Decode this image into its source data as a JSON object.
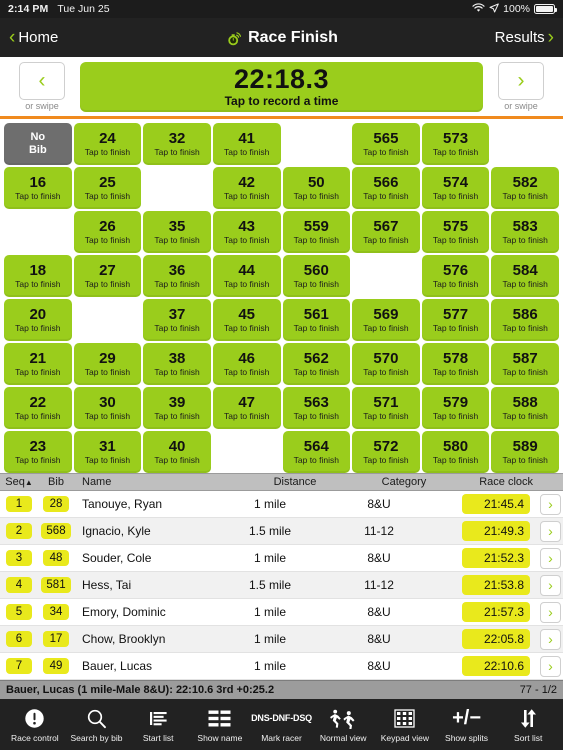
{
  "status_bar": {
    "time": "2:14 PM",
    "date": "Tue Jun 25",
    "wifi_icon": "wifi-icon",
    "location_icon": "location-arrow-icon",
    "battery_pct": "100%",
    "battery_icon": "battery-full-icon"
  },
  "nav": {
    "back_label": "Home",
    "back_icon": "chevron-left-icon",
    "title": "Race Finish",
    "logo_icon": "stopwatch-signal-icon",
    "forward_label": "Results",
    "forward_icon": "chevron-right-icon"
  },
  "timer": {
    "prev_icon": "chevron-left-icon",
    "prev_label": "or swipe",
    "next_icon": "chevron-right-icon",
    "next_label": "or swipe",
    "clock": "22:18.3",
    "hint": "Tap to record a time"
  },
  "colors": {
    "green": "#9ACD1C",
    "yellow": "#E9E91C",
    "orange_rule": "#F08A1E",
    "nobib_gray": "#6E6E6E",
    "dark_chrome": "#222222"
  },
  "grid": {
    "tile_sub": "Tap to finish",
    "no_bib_line1": "No",
    "no_bib_line2": "Bib",
    "columns": 8,
    "rows": [
      [
        "NOBIB",
        "24",
        "32",
        "41",
        "",
        "565",
        "573",
        ""
      ],
      [
        "16",
        "25",
        "",
        "42",
        "50",
        "566",
        "574",
        "582"
      ],
      [
        "",
        "26",
        "35",
        "43",
        "559",
        "567",
        "575",
        "583"
      ],
      [
        "18",
        "27",
        "36",
        "44",
        "560",
        "",
        "576",
        "584"
      ],
      [
        "20",
        "",
        "37",
        "45",
        "561",
        "569",
        "577",
        "586"
      ],
      [
        "21",
        "29",
        "38",
        "46",
        "562",
        "570",
        "578",
        "587"
      ],
      [
        "22",
        "30",
        "39",
        "47",
        "563",
        "571",
        "579",
        "588"
      ],
      [
        "23",
        "31",
        "40",
        "",
        "564",
        "572",
        "580",
        "589"
      ]
    ]
  },
  "results": {
    "headers": {
      "seq": "Seq",
      "seq_sort_icon": "sort-ascending-triangle-icon",
      "bib": "Bib",
      "name": "Name",
      "distance": "Distance",
      "category": "Category",
      "race_clock": "Race clock"
    },
    "row_arrow_icon": "chevron-right-icon",
    "rows": [
      {
        "seq": "1",
        "bib": "28",
        "name": "Tanouye, Ryan",
        "distance": "1 mile",
        "category": "8&U",
        "clock": "21:45.4"
      },
      {
        "seq": "2",
        "bib": "568",
        "name": "Ignacio, Kyle",
        "distance": "1.5 mile",
        "category": "11-12",
        "clock": "21:49.3"
      },
      {
        "seq": "3",
        "bib": "48",
        "name": "Souder, Cole",
        "distance": "1 mile",
        "category": "8&U",
        "clock": "21:52.3"
      },
      {
        "seq": "4",
        "bib": "581",
        "name": "Hess, Tai",
        "distance": "1.5 mile",
        "category": "11-12",
        "clock": "21:53.8"
      },
      {
        "seq": "5",
        "bib": "34",
        "name": "Emory, Dominic",
        "distance": "1 mile",
        "category": "8&U",
        "clock": "21:57.3"
      },
      {
        "seq": "6",
        "bib": "17",
        "name": "Chow, Brooklyn",
        "distance": "1 mile",
        "category": "8&U",
        "clock": "22:05.8"
      },
      {
        "seq": "7",
        "bib": "49",
        "name": "Bauer, Lucas",
        "distance": "1 mile",
        "category": "8&U",
        "clock": "22:10.6"
      }
    ]
  },
  "summary": {
    "detail": "Bauer, Lucas (1 mile-Male 8&U): 22:10.6 3rd +0:25.2",
    "counter": "77 - 1/2"
  },
  "toolbar": {
    "items": [
      {
        "label": "Race control",
        "icon": "exclamation-circle-icon"
      },
      {
        "label": "Search by bib",
        "icon": "magnifier-icon"
      },
      {
        "label": "Start list",
        "icon": "list-lines-icon"
      },
      {
        "label": "Show name",
        "icon": "two-column-rows-icon"
      },
      {
        "label": "Mark racer",
        "icon": "dns-dnf-dsq-text-icon",
        "text": "DNS-DNF-DSQ"
      },
      {
        "label": "Normal view",
        "icon": "runners-icon"
      },
      {
        "label": "Keypad view",
        "icon": "keypad-grid-icon"
      },
      {
        "label": "Show splits",
        "icon": "plus-minus-icon",
        "text": "+/−"
      },
      {
        "label": "Sort list",
        "icon": "up-down-arrows-icon"
      }
    ]
  }
}
